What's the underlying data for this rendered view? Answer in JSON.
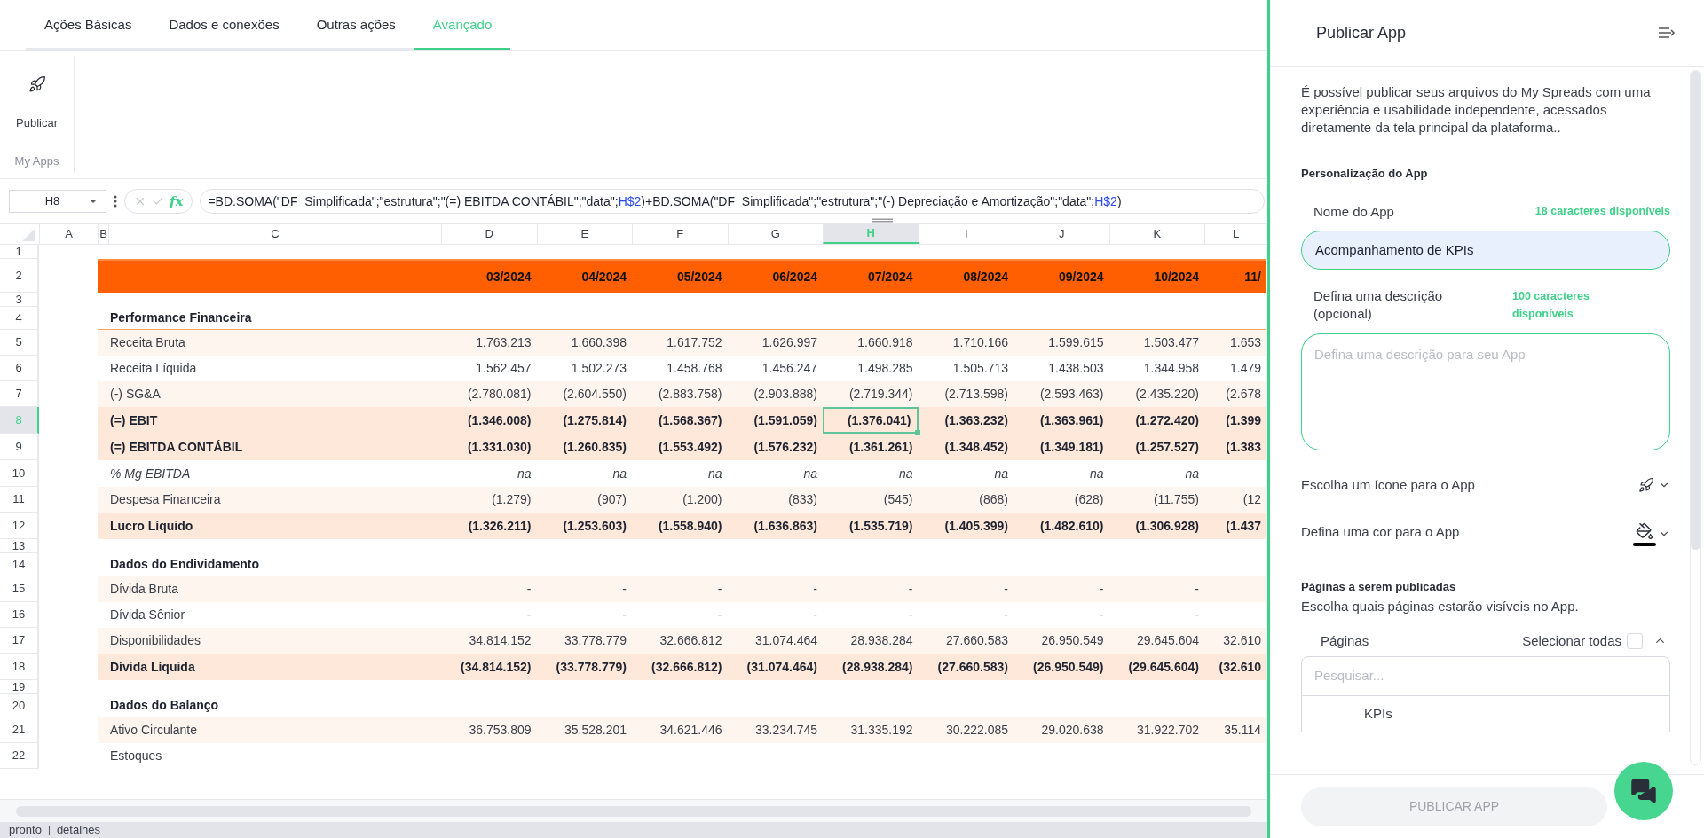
{
  "tabs": [
    {
      "label": "Ações Básicas",
      "selected": false
    },
    {
      "label": "Dados e conexões",
      "selected": false
    },
    {
      "label": "Outras ações",
      "selected": false
    },
    {
      "label": "Avançado",
      "selected": true
    }
  ],
  "ribbon": {
    "buttons": [
      {
        "label": "Publicar"
      }
    ],
    "group_label": "My Apps"
  },
  "formula_bar": {
    "cell_ref": "H8",
    "function_label": "fx",
    "formula": [
      {
        "kind": "text",
        "text": "=BD.SOMA(\"DF_Simplificada\";\"estrutura\";\"(=) EBITDA CONTÁBIL\";\"data\";"
      },
      {
        "kind": "ref",
        "text": "H$2"
      },
      {
        "kind": "text",
        "text": ")+BD.SOMA(\"DF_Simplificada\";\"estrutura\";\"(-) Depreciação e Amortização\";\"data\";"
      },
      {
        "kind": "ref",
        "text": "H$2"
      },
      {
        "kind": "text",
        "text": ")"
      }
    ]
  },
  "sheet": {
    "columns": [
      {
        "label": "A",
        "selected": false
      },
      {
        "label": "B",
        "selected": false
      },
      {
        "label": "C",
        "selected": false
      },
      {
        "label": "D",
        "selected": false
      },
      {
        "label": "E",
        "selected": false
      },
      {
        "label": "F",
        "selected": false
      },
      {
        "label": "G",
        "selected": false
      },
      {
        "label": "H",
        "selected": true
      },
      {
        "label": "I",
        "selected": false
      },
      {
        "label": "J",
        "selected": false
      },
      {
        "label": "K",
        "selected": false
      },
      {
        "label": "L",
        "selected": false
      }
    ],
    "rows": [
      {
        "number": "1",
        "kind": "spacer",
        "selected": false
      },
      {
        "number": "2",
        "kind": "dates",
        "selected": false,
        "values": [
          "03/2024",
          "04/2024",
          "05/2024",
          "06/2024",
          "07/2024",
          "08/2024",
          "09/2024",
          "10/2024",
          "11/"
        ]
      },
      {
        "number": "3",
        "kind": "spacer",
        "selected": false
      },
      {
        "number": "4",
        "kind": "section",
        "selected": false,
        "label": "Performance Financeira"
      },
      {
        "number": "5",
        "kind": "item",
        "shaded": true,
        "selected": false,
        "label": "Receita Bruta",
        "values": [
          "1.763.213",
          "1.660.398",
          "1.617.752",
          "1.626.997",
          "1.660.918",
          "1.710.166",
          "1.599.615",
          "1.503.477",
          "1.653"
        ]
      },
      {
        "number": "6",
        "kind": "item",
        "shaded": false,
        "selected": false,
        "label": "Receita Líquida",
        "values": [
          "1.562.457",
          "1.502.273",
          "1.458.768",
          "1.456.247",
          "1.498.285",
          "1.505.713",
          "1.438.503",
          "1.344.958",
          "1.479"
        ]
      },
      {
        "number": "7",
        "kind": "item",
        "shaded": true,
        "selected": false,
        "label": "(-) SG&A",
        "values": [
          "(2.780.081)",
          "(2.604.550)",
          "(2.883.758)",
          "(2.903.888)",
          "(2.719.344)",
          "(2.713.598)",
          "(2.593.463)",
          "(2.435.220)",
          "(2.678"
        ]
      },
      {
        "number": "8",
        "kind": "total",
        "selected": true,
        "label": "(=) EBIT",
        "values": [
          "(1.346.008)",
          "(1.275.814)",
          "(1.568.367)",
          "(1.591.059)",
          "(1.376.041)",
          "(1.363.232)",
          "(1.363.961)",
          "(1.272.420)",
          "(1.399"
        ]
      },
      {
        "number": "9",
        "kind": "total",
        "selected": false,
        "label": "(=) EBITDA CONTÁBIL",
        "values": [
          "(1.331.030)",
          "(1.260.835)",
          "(1.553.492)",
          "(1.576.232)",
          "(1.361.261)",
          "(1.348.452)",
          "(1.349.181)",
          "(1.257.527)",
          "(1.383"
        ]
      },
      {
        "number": "10",
        "kind": "ratio",
        "selected": false,
        "label": "% Mg EBITDA",
        "values": [
          "na",
          "na",
          "na",
          "na",
          "na",
          "na",
          "na",
          "na"
        ]
      },
      {
        "number": "11",
        "kind": "item",
        "shaded": true,
        "selected": false,
        "label": "Despesa Financeira",
        "values": [
          "(1.279)",
          "(907)",
          "(1.200)",
          "(833)",
          "(545)",
          "(868)",
          "(628)",
          "(11.755)",
          "(12"
        ]
      },
      {
        "number": "12",
        "kind": "total",
        "selected": false,
        "label": "Lucro Líquido",
        "values": [
          "(1.326.211)",
          "(1.253.603)",
          "(1.558.940)",
          "(1.636.863)",
          "(1.535.719)",
          "(1.405.399)",
          "(1.482.610)",
          "(1.306.928)",
          "(1.437"
        ]
      },
      {
        "number": "13",
        "kind": "spacer",
        "selected": false
      },
      {
        "number": "14",
        "kind": "section",
        "selected": false,
        "label": "Dados do Endividamento"
      },
      {
        "number": "15",
        "kind": "item",
        "shaded": true,
        "selected": false,
        "label": "Dívida Bruta",
        "values": [
          "-",
          "-",
          "-",
          "-",
          "-",
          "-",
          "-",
          "-"
        ]
      },
      {
        "number": "16",
        "kind": "item",
        "shaded": false,
        "selected": false,
        "label": "Dívida Sênior",
        "values": [
          "-",
          "-",
          "-",
          "-",
          "-",
          "-",
          "-",
          "-"
        ]
      },
      {
        "number": "17",
        "kind": "item",
        "shaded": true,
        "selected": false,
        "label": "Disponibilidades",
        "values": [
          "34.814.152",
          "33.778.779",
          "32.666.812",
          "31.074.464",
          "28.938.284",
          "27.660.583",
          "26.950.549",
          "29.645.604",
          "32.610"
        ]
      },
      {
        "number": "18",
        "kind": "total",
        "selected": false,
        "label": "Dívida Líquida",
        "values": [
          "(34.814.152)",
          "(33.778.779)",
          "(32.666.812)",
          "(31.074.464)",
          "(28.938.284)",
          "(27.660.583)",
          "(26.950.549)",
          "(29.645.604)",
          "(32.610"
        ]
      },
      {
        "number": "19",
        "kind": "spacer",
        "selected": false
      },
      {
        "number": "20",
        "kind": "section",
        "selected": false,
        "label": "Dados do Balanço"
      },
      {
        "number": "21",
        "kind": "item",
        "shaded": true,
        "selected": false,
        "label": "Ativo Circulante",
        "values": [
          "36.753.809",
          "35.528.201",
          "34.621.446",
          "33.234.745",
          "31.335.192",
          "30.222.085",
          "29.020.638",
          "31.922.702",
          "35.114"
        ]
      },
      {
        "number": "22",
        "kind": "item",
        "shaded": false,
        "selected": false,
        "label": "Estoques"
      }
    ]
  },
  "status_bar": [
    "pronto",
    "detalhes"
  ],
  "panel": {
    "title": "Publicar App",
    "intro": "É possível publicar seus arquivos do My Spreads com uma experiência e usabilidade independente, acessados diretamente da tela principal da plataforma..",
    "section_title": "Personalização do App",
    "name_field": {
      "label": "Nome do App",
      "counter": "18 caracteres disponíveis",
      "value": "Acompanhamento de KPIs"
    },
    "description_field": {
      "label": "Defina uma descrição (opcional)",
      "counter": "100 caracteres disponíveis",
      "placeholder": "Defina uma descrição para seu App"
    },
    "icon_picker": {
      "label": "Escolha um ícone para o App"
    },
    "color_picker": {
      "label": "Defina uma cor para o App",
      "color": "#000000"
    },
    "pages": {
      "title": "Páginas a serem publicadas",
      "subtitle": "Escolha quais páginas estarão visíveis no App.",
      "list_label": "Páginas",
      "select_all_label": "Selecionar todas",
      "select_all_checked": false,
      "expanded": true,
      "search_placeholder": "Pesquisar...",
      "items": [
        {
          "label": "KPIs"
        }
      ]
    },
    "submit_button": {
      "label": "PUBLICAR APP",
      "disabled": true
    }
  }
}
